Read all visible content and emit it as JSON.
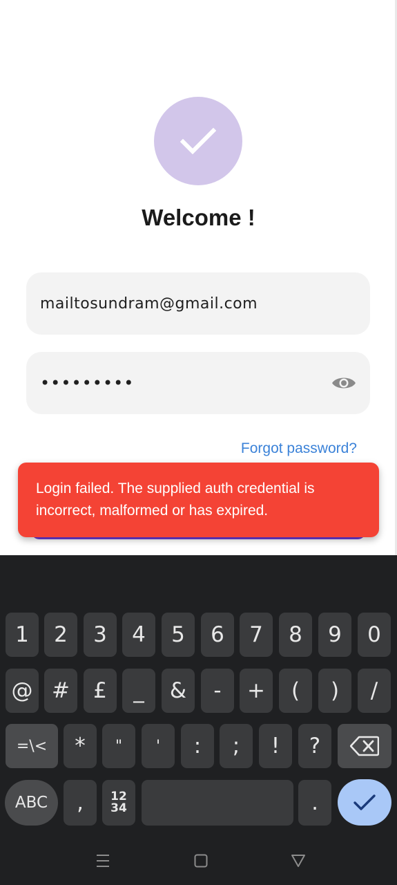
{
  "login": {
    "title": "Welcome !",
    "email_value": "mailtosundram@gmail.com",
    "password_masked": "•••••••••",
    "forgot_password_label": "Forgot password?",
    "logo_icon": "check-icon"
  },
  "snackbar": {
    "message": "Login failed. The supplied auth credential is incorrect, malformed or has expired."
  },
  "keyboard": {
    "row1": [
      "1",
      "2",
      "3",
      "4",
      "5",
      "6",
      "7",
      "8",
      "9",
      "0"
    ],
    "row2": [
      "@",
      "#",
      "£",
      "_",
      "&",
      "-",
      "+",
      "(",
      ")",
      "/"
    ],
    "row3": {
      "symbols_toggle": "=\\<",
      "keys": [
        "*",
        "\"",
        "'",
        ":",
        ";",
        "!",
        "?"
      ],
      "backspace_icon": "backspace-icon"
    },
    "row4": {
      "abc_label": "ABC",
      "comma": ",",
      "numpad_top": "12",
      "numpad_bottom": "34",
      "period": ".",
      "enter_icon": "check-icon"
    }
  },
  "navbar": {
    "icons": [
      "menu-icon",
      "home-icon",
      "back-icon"
    ]
  },
  "colors": {
    "logo_circle": "#d2c6ea",
    "link": "#3b82d8",
    "snackbar_error": "#f44335",
    "keyboard_bg": "#1f2022",
    "enter_key": "#a9c8f7"
  }
}
